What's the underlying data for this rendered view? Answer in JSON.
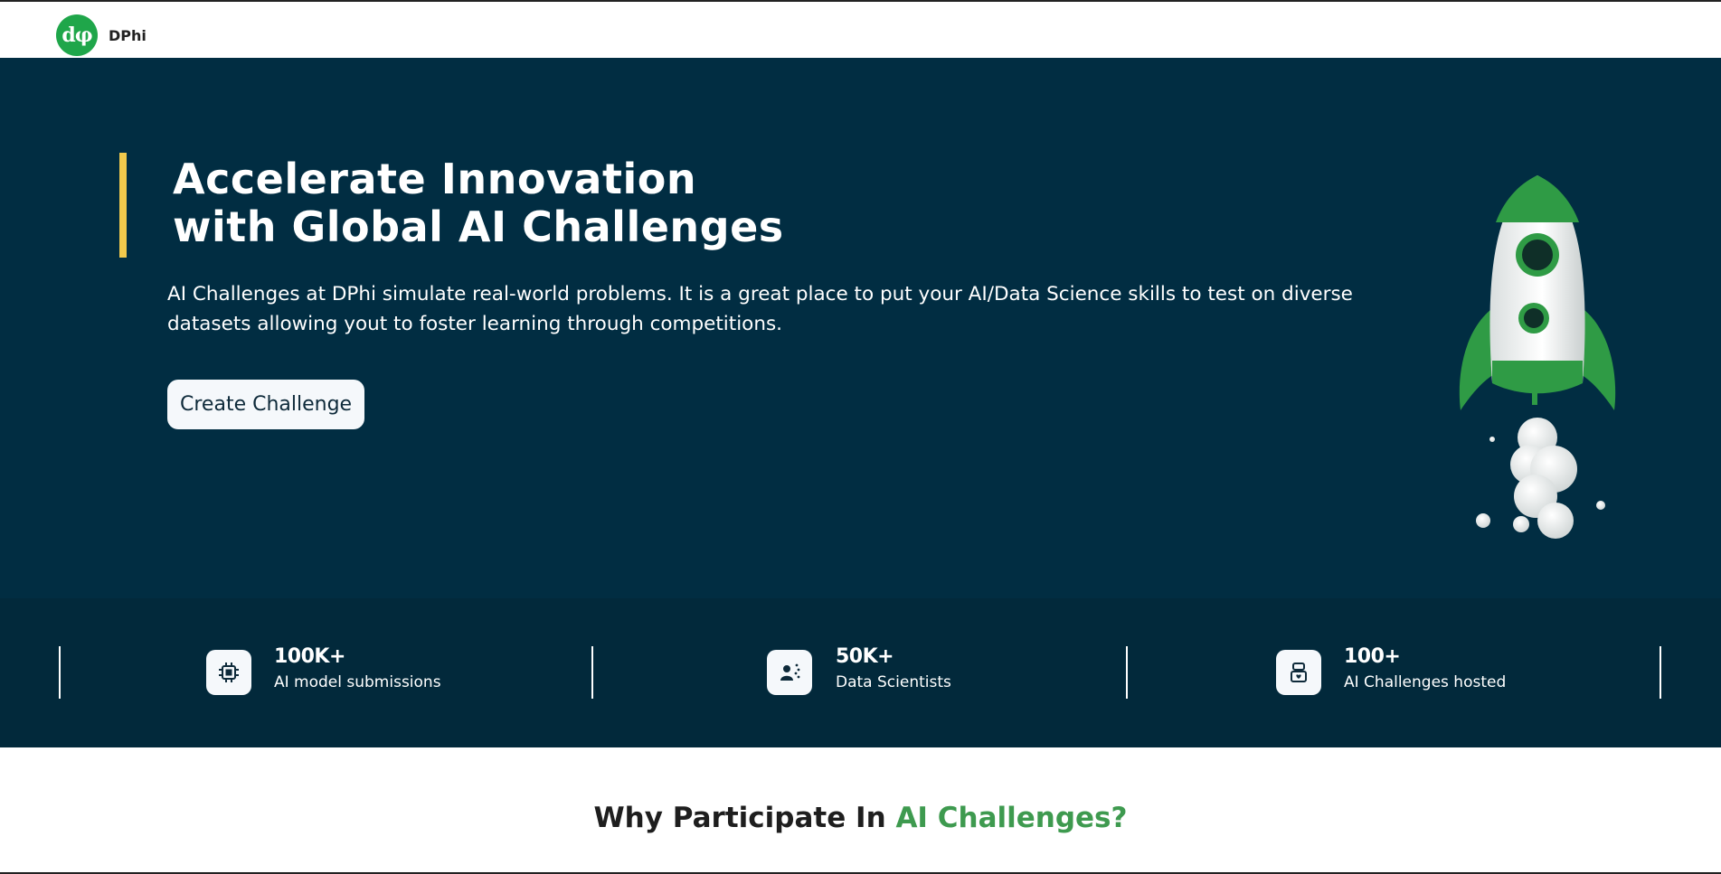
{
  "header": {
    "logo_mark": "dφ",
    "brand": "DPhi"
  },
  "hero": {
    "title_line1": "Accelerate Innovation",
    "title_line2": "with Global AI Challenges",
    "description": "AI Challenges at DPhi simulate real-world problems. It is a great place to put your AI/Data Science skills to test on diverse datasets allowing yout to foster learning through competitions.",
    "cta_label": "Create Challenge",
    "accent_color": "#f2c94c",
    "background_color": "#012d42",
    "illustration_icon": "rocket-illustration"
  },
  "stats": [
    {
      "icon": "ai-chip-icon",
      "value": "100K+",
      "label": "AI model submissions"
    },
    {
      "icon": "data-scientist-icon",
      "value": "50K+",
      "label": "Data Scientists"
    },
    {
      "icon": "robot-icon",
      "value": "100+",
      "label": "AI Challenges hosted"
    }
  ],
  "why": {
    "title_prefix": "Why Participate In ",
    "title_highlight": "AI Challenges?",
    "highlight_color": "#3e9a4f"
  },
  "colors": {
    "brand_green": "#1fa64a",
    "stats_background": "#02293b"
  }
}
